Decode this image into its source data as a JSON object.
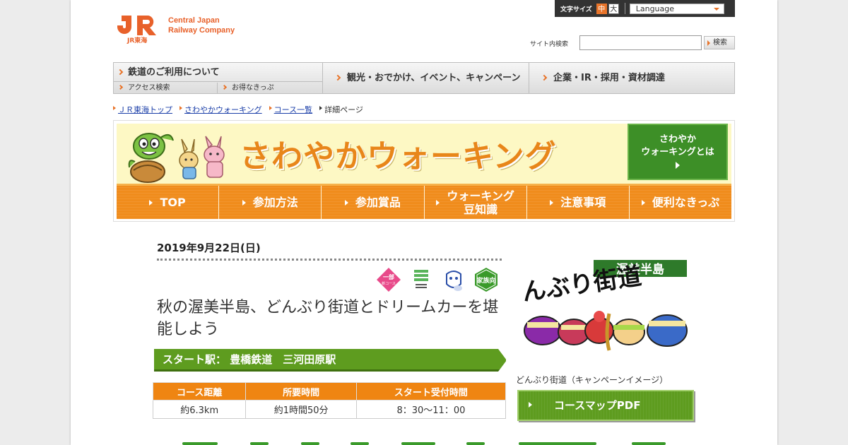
{
  "header": {
    "logo_mark": "JR",
    "logo_sub": "JR東海",
    "logo_line1": "Central Japan",
    "logo_line2": "Railway Company",
    "fontsize_label": "文字サイズ",
    "fontsize_medium": "中",
    "fontsize_large": "大",
    "language_label": "Language",
    "search_label": "サイト内検索",
    "search_value": "",
    "search_button": "検索"
  },
  "gnav": {
    "main": "鉄道のご利用について",
    "sub1": "アクセス検索",
    "sub2": "お得なきっぷ",
    "item2": "観光・おでかけ、イベント、キャンペーン",
    "item3": "企業・IR・採用・資材調達"
  },
  "breadcrumb": {
    "home": "ＪＲ東海トップ",
    "walking": "さわやかウォーキング",
    "list": "コース一覧",
    "current": "詳細ページ"
  },
  "banner": {
    "title": "さわやかウォーキング",
    "about_line1": "さわやか",
    "about_line2": "ウォーキングとは",
    "nav": [
      "TOP",
      "参加方法",
      "参加賞品",
      "ウォーキング",
      "豆知識",
      "注意事項",
      "便利なきっぷ"
    ]
  },
  "event": {
    "date": "2019年9月22日(日)",
    "title": "秋の渥美半島、どんぶり街道とドリームカーを堪能しよう",
    "start_station": "スタート駅： 豊橋鉄道　三河田原駅",
    "badges": {
      "partial_course": "一部",
      "partial_course_sub": "新コース",
      "family": "家族向"
    },
    "table": {
      "headers": [
        "コース距離",
        "所要時間",
        "スタート受付時間"
      ],
      "values": [
        "約6.3km",
        "約1時間50分",
        "8：30～11：00"
      ]
    }
  },
  "side": {
    "image_title": "渥美半島",
    "image_text": "どんぶり街道",
    "caption": "どんぶり街道（キャンペーンイメージ）",
    "pdf_button": "コースマップPDF"
  },
  "colors": {
    "brand_orange": "#e8612a",
    "nav_orange": "#f08c1c",
    "walking_green": "#5e9c1f"
  }
}
